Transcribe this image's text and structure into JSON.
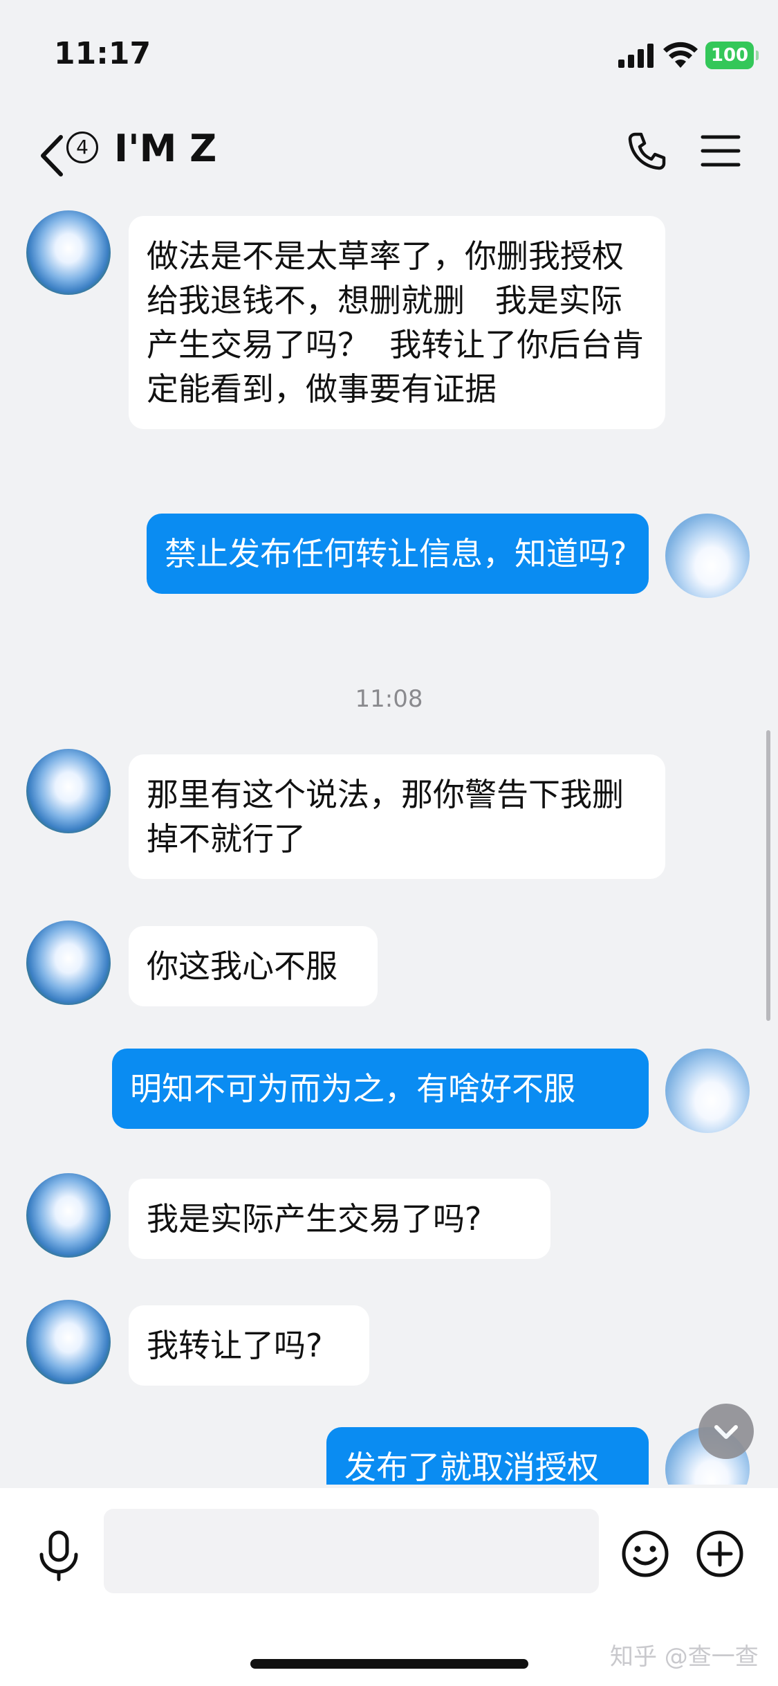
{
  "status": {
    "time": "11:17",
    "battery": "100"
  },
  "header": {
    "unread_count": "4",
    "title": "I'M Z"
  },
  "messages": [
    {
      "text": "做法是不是太草率了，你删我授权给我退钱不，想删就删   我是实际产生交易了吗？  我转让了你后台肯定能看到，做事要有证据"
    },
    {
      "text": "禁止发布任何转让信息，知道吗?"
    },
    {
      "text": "那里有这个说法，那你警告下我删掉不就行了"
    },
    {
      "text": "你这我心不服"
    },
    {
      "text": "明知不可为而为之，有啥好不服"
    },
    {
      "text": "我是实际产生交易了吗?"
    },
    {
      "text": "我转让了吗?"
    },
    {
      "text": "发布了就取消授权"
    }
  ],
  "timestamp": "11:08",
  "input": {
    "placeholder": ""
  },
  "watermark": "知乎 @查一查",
  "colors": {
    "outgoing_bubble": "#0a8cf2",
    "incoming_bubble": "#ffffff",
    "battery": "#34c759"
  },
  "icons": [
    "back-arrow-icon",
    "phone-icon",
    "menu-icon",
    "microphone-icon",
    "emoji-icon",
    "plus-icon",
    "chevron-down-icon"
  ]
}
